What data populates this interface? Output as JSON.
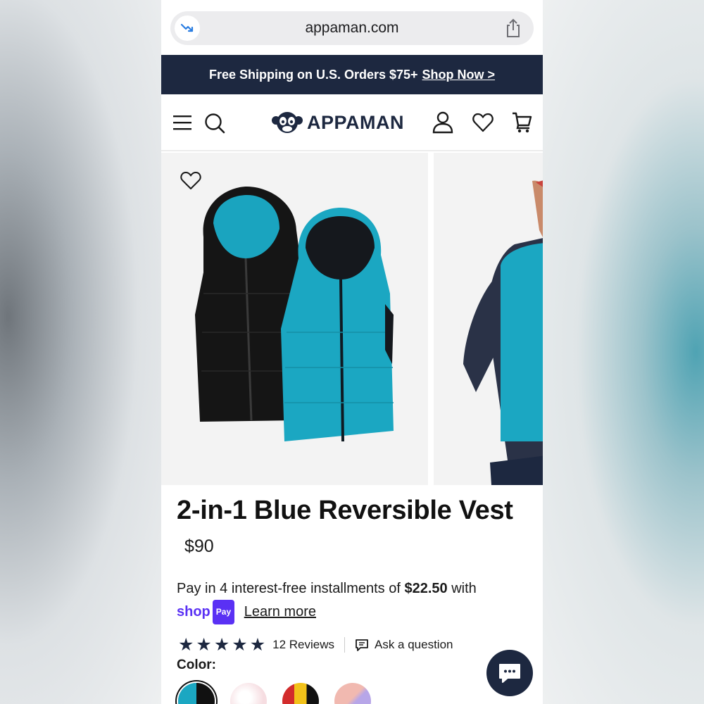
{
  "browser": {
    "url": "appaman.com"
  },
  "promo": {
    "text": "Free Shipping on U.S. Orders $75+",
    "link": "Shop Now >"
  },
  "header": {
    "logo_text": "APPAMAN"
  },
  "product": {
    "title": "2-in-1 Blue Reversible Vest",
    "price": "$90",
    "installments_prefix": "Pay in 4 interest-free installments of",
    "installment_amount": "$22.50",
    "installments_suffix": "with",
    "shop_word": "shop",
    "pay_word": "Pay",
    "learn_more": "Learn more",
    "rating": 5,
    "reviews_label": "12 Reviews",
    "ask_question": "Ask a question",
    "color_label": "Color:"
  },
  "swatches": [
    {
      "name": "blue-black",
      "colors": [
        "#1ba7c2",
        "#111111"
      ],
      "selected": true
    },
    {
      "name": "pink-white",
      "colors": [
        "#f6dde1",
        "#ffffff"
      ],
      "selected": false
    },
    {
      "name": "multicolor",
      "colors": [
        "#d22c2c",
        "#f2c21a"
      ],
      "selected": false
    },
    {
      "name": "pastel",
      "colors": [
        "#f1b9b0",
        "#b7a6e8"
      ],
      "selected": false
    }
  ],
  "colors": {
    "navy": "#1d2840",
    "vest_blue": "#1ba7c2",
    "shop_pay_purple": "#5a31f4"
  },
  "icons": [
    "trending-icon",
    "share-icon",
    "menu-icon",
    "search-icon",
    "logo-monkey-icon",
    "account-icon",
    "wishlist-icon",
    "cart-icon",
    "heart-icon",
    "star-icon",
    "chat-bubble-icon",
    "chat-icon"
  ]
}
